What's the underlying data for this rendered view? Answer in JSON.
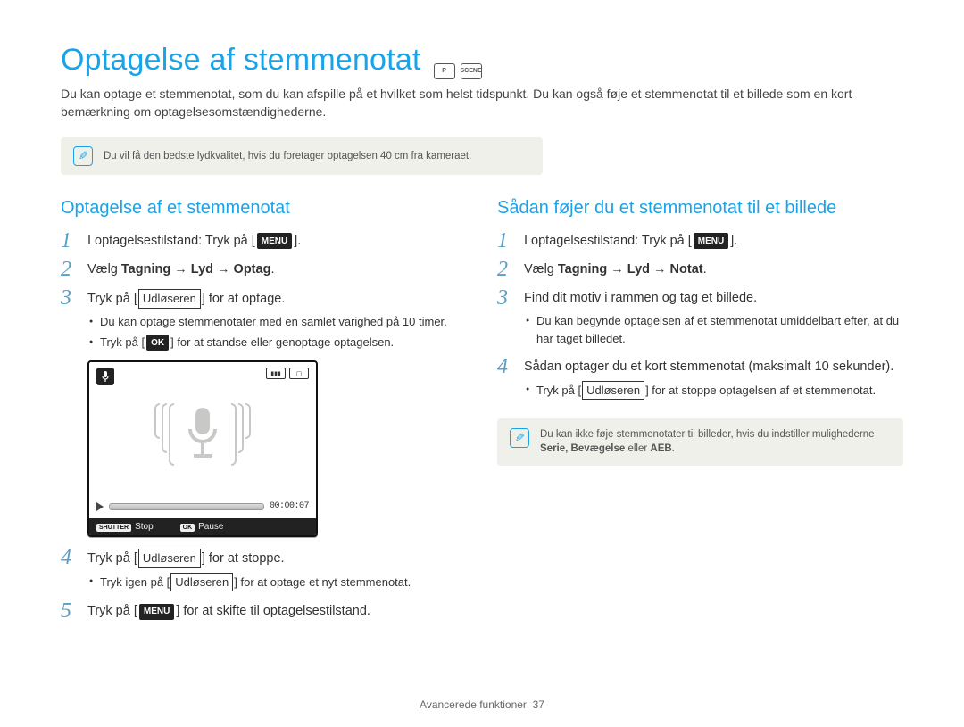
{
  "title": "Optagelse af stemmenotat",
  "title_mode_icons": [
    "P",
    "SCENE"
  ],
  "intro": "Du kan optage et stemmenotat, som du kan afspille på et hvilket som helst tidspunkt. Du kan også føje et stemmenotat til et billede som en kort bemærkning om optagelsesomstændighederne.",
  "top_note": "Du vil få den bedste lydkvalitet, hvis du foretager optagelsen 40 cm fra kameraet.",
  "left": {
    "heading": "Optagelse af et stemmenotat",
    "step1_prefix": "I optagelsestilstand: Tryk på [",
    "step1_badge": "MENU",
    "step1_suffix": "].",
    "step2_prefix": "Vælg ",
    "step2_bold": "Tagning → Lyd → Optag",
    "step2_suffix": ".",
    "step3_prefix": "Tryk på [",
    "step3_box": "Udløseren",
    "step3_suffix": "] for at optage.",
    "step3_bullets_a": "Du kan optage stemmenotater med en samlet varighed på 10 timer.",
    "step3_bullet_b_prefix": "Tryk på [",
    "step3_bullet_b_badge": "OK",
    "step3_bullet_b_suffix": "] for at standse eller genoptage optagelsen.",
    "screen": {
      "time": "00:00:07",
      "bottom_left_key": "SHUTTER",
      "bottom_left_label": "Stop",
      "bottom_right_key": "OK",
      "bottom_right_label": "Pause"
    },
    "step4_prefix": "Tryk på [",
    "step4_box": "Udløseren",
    "step4_suffix": "] for at stoppe.",
    "step4_bullet_prefix": "Tryk igen på [",
    "step4_bullet_box": "Udløseren",
    "step4_bullet_suffix": "] for at optage et nyt stemmenotat.",
    "step5_prefix": "Tryk på [",
    "step5_badge": "MENU",
    "step5_suffix": "] for at skifte til optagelsestilstand."
  },
  "right": {
    "heading": "Sådan føjer du et stemmenotat til et billede",
    "step1_prefix": "I optagelsestilstand: Tryk på [",
    "step1_badge": "MENU",
    "step1_suffix": "].",
    "step2_prefix": "Vælg ",
    "step2_bold": "Tagning → Lyd → Notat",
    "step2_suffix": ".",
    "step3": "Find dit motiv i rammen og tag et billede.",
    "step3_bullet": "Du kan begynde optagelsen af et stemmenotat umiddelbart efter, at du har taget billedet.",
    "step4": "Sådan optager du et kort stemmenotat (maksimalt 10 sekunder).",
    "step4_bullet_prefix": "Tryk på [",
    "step4_bullet_box": "Udløseren",
    "step4_bullet_suffix": "] for at stoppe optagelsen af et stemmenotat.",
    "note_line1": "Du kan ikke føje stemmenotater til billeder, hvis du indstiller mulighederne",
    "note_line2_prefix": "",
    "note_line2_bold": "Serie, Bevægelse ",
    "note_line2_mid": "eller ",
    "note_line2_bold2": "AEB",
    "note_line2_suffix": "."
  },
  "footer_label": "Avancerede funktioner",
  "footer_page": "37",
  "step_nums": {
    "n1": "1",
    "n2": "2",
    "n3": "3",
    "n4": "4",
    "n5": "5"
  }
}
